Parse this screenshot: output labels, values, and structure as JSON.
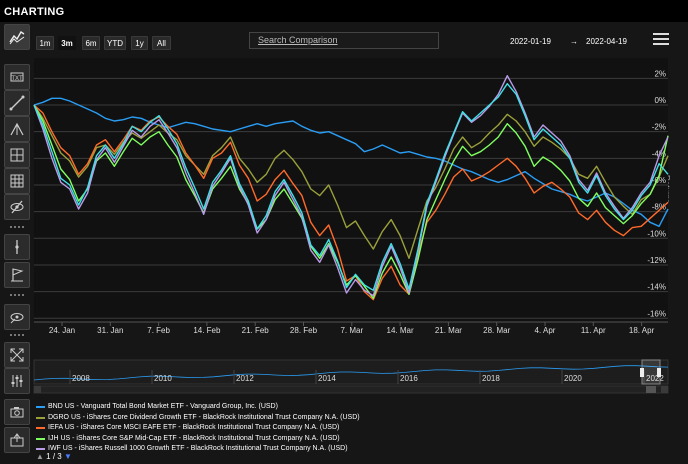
{
  "app": {
    "title": "CHARTING"
  },
  "ranges": [
    {
      "label": "1m",
      "active": false
    },
    {
      "label": "3m",
      "active": true
    },
    {
      "label": "6m",
      "active": false
    },
    {
      "label": "YTD",
      "active": false
    },
    {
      "label": "1y",
      "active": false
    },
    {
      "label": "All",
      "active": false
    }
  ],
  "search": {
    "placeholder": "Search Comparison"
  },
  "dates": {
    "start": "2022-01-19",
    "arrow": "→",
    "end": "2022-04-19"
  },
  "tools": [
    "trend-chart-icon",
    "text-tool-icon",
    "line-tool-icon",
    "pitchfork-icon",
    "crosshair-icon",
    "grid-icon",
    "hide-icon",
    "vertical-line-icon",
    "flag-icon",
    "magnet-icon",
    "expand-icon",
    "indicators-icon",
    "camera-icon",
    "share-icon"
  ],
  "navigator": {
    "years": [
      "2008",
      "2010",
      "2012",
      "2014",
      "2016",
      "2018",
      "2020",
      "2022"
    ]
  },
  "pager": {
    "text": "1 / 3",
    "up": "▲",
    "down": "▼"
  },
  "chart_data": {
    "type": "line",
    "ylabel": "Returns",
    "yticks": [
      "2%",
      "0%",
      "-2%",
      "-4%",
      "-6%",
      "-8%",
      "-10%",
      "-12%",
      "-14%",
      "-16%"
    ],
    "ylim": [
      -16,
      3
    ],
    "xticks": [
      "24. Jan",
      "31. Jan",
      "7. Feb",
      "14. Feb",
      "21. Feb",
      "28. Feb",
      "7. Mar",
      "14. Mar",
      "21. Mar",
      "28. Mar",
      "4. Apr",
      "11. Apr",
      "18. Apr"
    ],
    "grid": true,
    "series": [
      {
        "name": "BND US - Vanguard Total Bond Market ETF - Vanguard Group, Inc. (USD)",
        "color": "#2a9df4",
        "values": [
          0,
          0.2,
          0.5,
          0.5,
          0.3,
          0,
          -0.3,
          -0.6,
          -1,
          -1.2,
          -1.1,
          -0.9,
          -1,
          -1.3,
          -1.5,
          -1.7,
          -1.5,
          -1.3,
          -1.4,
          -1.6,
          -1.8,
          -1.9,
          -2,
          -1.8,
          -1.6,
          -1.4,
          -1.6,
          -1.4,
          -1.3,
          -1.2,
          -1.6,
          -1.9,
          -2.1,
          -2,
          -2.3,
          -2.6,
          -2.9,
          -3.5,
          -3.3,
          -3,
          -3.3,
          -3.6,
          -3.5,
          -3.7,
          -3.9,
          -4,
          -4.2,
          -4.5,
          -4.8,
          -5,
          -5.3,
          -5.6,
          -5.8,
          -5.6,
          -5.3,
          -5,
          -5.5,
          -5.9,
          -6.3,
          -6.5,
          -6.7,
          -7,
          -7.2,
          -6.9,
          -6.6,
          -6.9,
          -7.4,
          -7.9,
          -8.2,
          -8.8,
          -9.1,
          -7.8
        ]
      },
      {
        "name": "DGRO US - iShares Core Dividend Growth ETF - BlackRock Institutional Trust Company N.A. (USD)",
        "color": "#9aa03a",
        "values": [
          0,
          -1,
          -2.3,
          -3.6,
          -4.2,
          -5.4,
          -4.6,
          -3.2,
          -3,
          -3.7,
          -2.8,
          -2.1,
          -2.5,
          -2,
          -1.5,
          -2.1,
          -2.6,
          -3.8,
          -4.5,
          -5.2,
          -3.8,
          -3.2,
          -2.4,
          -4,
          -4.8,
          -5.8,
          -5.2,
          -4,
          -3.4,
          -4.1,
          -5,
          -6.3,
          -6.8,
          -6,
          -7.5,
          -9.2,
          -8.7,
          -9.8,
          -10.8,
          -9.5,
          -8.6,
          -9.8,
          -11.5,
          -9.3,
          -7.2,
          -6.2,
          -4.8,
          -3.3,
          -2.4,
          -3.2,
          -2.8,
          -2.1,
          -1.5,
          -0.7,
          -1.2,
          -2,
          -3.1,
          -2.4,
          -2.8,
          -3.3,
          -4,
          -5.2,
          -5.5,
          -4.6,
          -5.8,
          -6.9,
          -7.6,
          -8.2,
          -7.1,
          -6.7,
          -5.4,
          -3.8
        ]
      },
      {
        "name": "IEFA US - iShares Core MSCI EAFE ETF - BlackRock Institutional Trust Company N.A. (USD)",
        "color": "#ff6a2a",
        "values": [
          0,
          -0.6,
          -2,
          -3.2,
          -3.8,
          -5.2,
          -4.4,
          -3,
          -2.6,
          -3.5,
          -2.6,
          -1.6,
          -1.9,
          -1.2,
          -0.9,
          -1.6,
          -2.2,
          -3.6,
          -4.5,
          -5.5,
          -4,
          -3.6,
          -2.8,
          -4.5,
          -5.5,
          -7.2,
          -6.7,
          -5.6,
          -4.9,
          -5.9,
          -6.8,
          -8.8,
          -9.8,
          -9,
          -10.8,
          -13.2,
          -12.8,
          -14,
          -14.6,
          -13,
          -12.1,
          -13.5,
          -14.2,
          -11.2,
          -8.8,
          -7.9,
          -6.7,
          -5.4,
          -4.8,
          -5.7,
          -5.4,
          -5,
          -4.5,
          -4,
          -4.6,
          -5.5,
          -6.6,
          -6.1,
          -5.8,
          -6.3,
          -6.9,
          -8.1,
          -8.6,
          -7.9,
          -8.8,
          -9.4,
          -9.8,
          -9.2,
          -9.1,
          -8.5,
          -7.9,
          -7.3
        ]
      },
      {
        "name": "IJH US - iShares Core S&P Mid-Cap ETF - BlackRock Institutional Trust Company N.A. (USD)",
        "color": "#7fff5f",
        "values": [
          0,
          -1.2,
          -3,
          -4.8,
          -5.6,
          -7.2,
          -6.3,
          -4.2,
          -3.6,
          -4.6,
          -3.5,
          -2.5,
          -3,
          -2.4,
          -2,
          -3,
          -3.9,
          -5.6,
          -6.8,
          -8.1,
          -6.3,
          -5.5,
          -4.6,
          -6.3,
          -7.4,
          -9.3,
          -8.6,
          -7.1,
          -6.3,
          -7.4,
          -8.5,
          -10.6,
          -11.5,
          -10.4,
          -11.8,
          -13.5,
          -12.8,
          -13.6,
          -14.5,
          -12.6,
          -11.4,
          -12.7,
          -14.2,
          -11.6,
          -8.6,
          -7.1,
          -5.6,
          -4.2,
          -3.1,
          -3.8,
          -3.5,
          -3,
          -2.4,
          -1.4,
          -2.1,
          -3.1,
          -4.6,
          -3.9,
          -4.3,
          -4.9,
          -5.7,
          -7,
          -7.6,
          -6.6,
          -7.7,
          -8.3,
          -8.9,
          -8.3,
          -7.4,
          -6.7,
          -5.3,
          -2.3
        ]
      },
      {
        "name": "IWF US - iShares Russell 1000 Growth ETF - BlackRock Institutional Trust Company N.A. (USD)",
        "color": "#b99be8",
        "values": [
          0,
          -1.8,
          -4,
          -5.8,
          -6.3,
          -7.8,
          -6.6,
          -4.1,
          -3.2,
          -4.3,
          -3.1,
          -1.9,
          -2.4,
          -1.6,
          -1.1,
          -2.1,
          -3.2,
          -5.1,
          -6.6,
          -8.2,
          -6.1,
          -5.1,
          -4,
          -6.1,
          -7.5,
          -9.6,
          -8.6,
          -6.8,
          -5.8,
          -7.1,
          -8.4,
          -10.9,
          -11.8,
          -10.5,
          -12.2,
          -14.1,
          -13.1,
          -13.9,
          -14.3,
          -12.1,
          -10.6,
          -12.2,
          -14.1,
          -11,
          -7.6,
          -5.8,
          -3.9,
          -2.2,
          -0.6,
          -1.3,
          -0.8,
          -0.1,
          0.8,
          2.2,
          1,
          -0.6,
          -2.4,
          -1.5,
          -2.1,
          -2.7,
          -3.8,
          -5.6,
          -6.4,
          -5.1,
          -6.6,
          -7.6,
          -8.5,
          -7.7,
          -6.6,
          -5.8,
          -3.8,
          -2.4
        ]
      },
      {
        "name": "",
        "color": "#3ee0e6",
        "values": [
          0,
          -1.5,
          -3.5,
          -5.5,
          -6,
          -7.5,
          -6.2,
          -3.8,
          -3,
          -4,
          -2.9,
          -1.6,
          -2,
          -1.3,
          -0.8,
          -1.8,
          -2.9,
          -4.7,
          -6.2,
          -7.8,
          -5.8,
          -4.9,
          -3.8,
          -5.9,
          -7.2,
          -9.3,
          -8.3,
          -6.5,
          -5.6,
          -6.8,
          -8.1,
          -10.5,
          -11.3,
          -10.1,
          -11.7,
          -13.7,
          -12.7,
          -13.5,
          -13.9,
          -11.8,
          -10.4,
          -11.9,
          -13.8,
          -10.8,
          -7.4,
          -5.6,
          -3.7,
          -2.1,
          -0.5,
          -1.2,
          -0.6,
          0,
          0.6,
          1.6,
          0.8,
          -0.8,
          -2.6,
          -1.8,
          -2.4,
          -3,
          -4,
          -5.8,
          -6.6,
          -5.3,
          -6.8,
          -7.8,
          -8.6,
          -7.9,
          -6.8,
          -6,
          -4.4,
          -5.2
        ]
      }
    ]
  }
}
